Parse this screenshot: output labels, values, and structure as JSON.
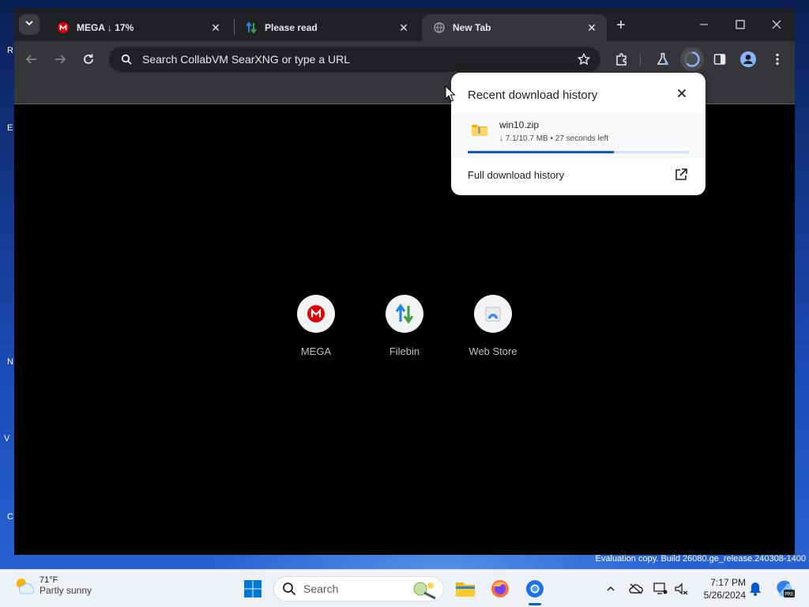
{
  "browser": {
    "tabs": [
      {
        "title": "MEGA ↓ 17%",
        "favicon": "mega-icon",
        "active": false
      },
      {
        "title": "Please read",
        "favicon": "filebin-icon",
        "active": false
      },
      {
        "title": "New Tab",
        "favicon": "globe-icon",
        "active": true
      }
    ],
    "omnibox_placeholder": "Search CollabVM SearXNG or type a URL"
  },
  "ntp": {
    "shortcuts": [
      {
        "label": "MEGA",
        "icon": "mega-icon"
      },
      {
        "label": "Filebin",
        "icon": "filebin-icon"
      },
      {
        "label": "Web Store",
        "icon": "web-store-icon"
      }
    ]
  },
  "download_bubble": {
    "title": "Recent download history",
    "item": {
      "filename": "win10.zip",
      "status": "↓ 7.1/10.7 MB • 27 seconds left",
      "progress": 0.66
    },
    "full_history_label": "Full download history"
  },
  "desktop": {
    "watermark_line": "Evaluation copy. Build 26080.ge_release.240308-1400",
    "edge_letters": [
      "R",
      "E",
      "N",
      "V",
      "C"
    ]
  },
  "taskbar": {
    "weather": {
      "temp": "71°F",
      "desc": "Partly sunny"
    },
    "search_label": "Search",
    "clock": {
      "time": "7:17 PM",
      "date": "5/26/2024"
    }
  },
  "colors": {
    "accent": "#0b57d0",
    "mega_red": "#d90007",
    "window_bg": "#000000",
    "toolbar_bg": "#35363a"
  }
}
